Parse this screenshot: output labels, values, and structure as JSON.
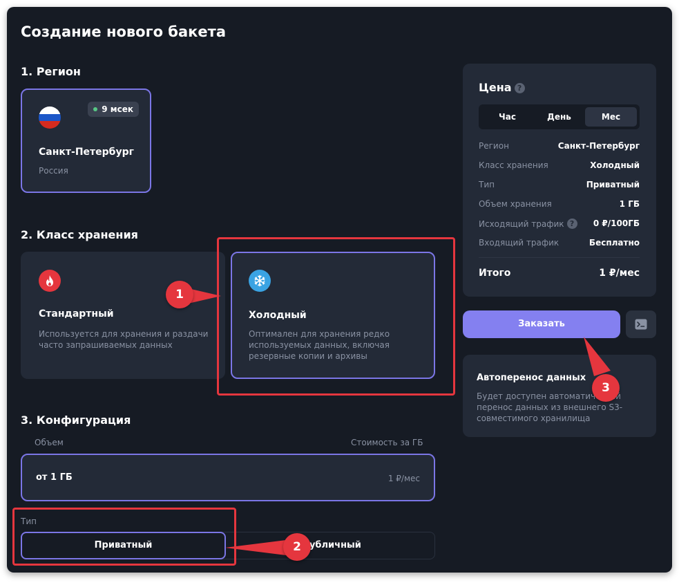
{
  "page": {
    "title": "Создание нового бакета"
  },
  "region": {
    "heading": "1. Регион",
    "card": {
      "city": "Санкт-Петербург",
      "country": "Россия",
      "latency": "9 мсек",
      "flag_icon": "russia-flag-icon"
    }
  },
  "storage_class": {
    "heading": "2. Класс хранения",
    "options": [
      {
        "title": "Стандартный",
        "description_lines": [
          "Используется для хранения и раздачи",
          "часто запрашиваемых данных"
        ],
        "icon": "fire-icon",
        "color": "#e5363e"
      },
      {
        "title": "Холодный",
        "description_lines": [
          "Оптимален для хранения редко",
          "используемых данных, включая",
          "резервные копии и архивы"
        ],
        "icon": "snowflake-icon",
        "color": "#3aa3e3"
      }
    ]
  },
  "config": {
    "heading": "3. Конфигурация",
    "volume_label": "Объем",
    "cost_label": "Стоимость за ГБ",
    "volume_value": "от 1 ГБ",
    "volume_price": "1 ₽/мес",
    "type_label": "Тип",
    "type_options": [
      "Приватный",
      "Публичный"
    ],
    "type_selected": "Приватный"
  },
  "price": {
    "title": "Цена",
    "tabs": [
      "Час",
      "День",
      "Мес"
    ],
    "active_tab": "Мес",
    "rows": [
      {
        "label": "Регион",
        "value": "Санкт-Петербург"
      },
      {
        "label": "Класс хранения",
        "value": "Холодный"
      },
      {
        "label": "Тип",
        "value": "Приватный"
      },
      {
        "label": "Объем хранения",
        "value": "1 ГБ"
      },
      {
        "label": "Исходящий трафик",
        "value": "0 ₽/100ГБ"
      },
      {
        "label": "Входящий трафик",
        "value": "Бесплатно"
      }
    ],
    "total_label": "Итого",
    "total_value": "1 ₽/мес"
  },
  "order_button": "Заказать",
  "terminal_icon": "terminal-icon",
  "help_icon": "question-icon",
  "autotransfer": {
    "title": "Автоперенос данных",
    "description_lines": [
      "Будет доступен автоматический",
      "перенос данных из внешнего S3-",
      "совместимого хранилища"
    ]
  },
  "annotations": [
    "1",
    "2",
    "3"
  ],
  "colors": {
    "accent": "#8480f0",
    "annotation": "#e5363e",
    "background": "#161b24",
    "card": "#232a37"
  }
}
